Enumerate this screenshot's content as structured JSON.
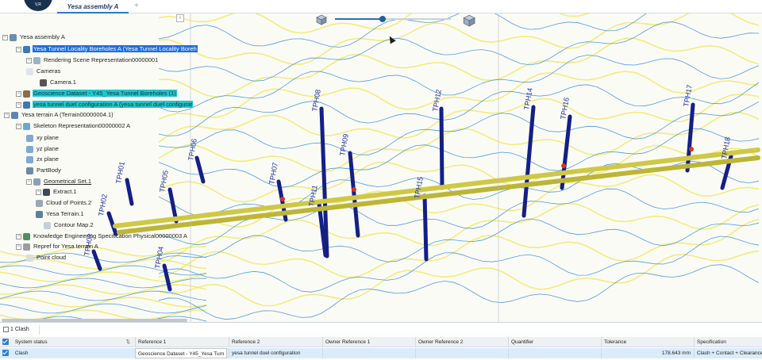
{
  "header": {
    "logo_text": "V,R",
    "tab_label": "Yesa assembly A",
    "add_tab_symbol": "+"
  },
  "tree": {
    "collapse_symbol": "‹",
    "nodes": [
      {
        "label": "Yesa assembly A",
        "icon": "assembly-icon",
        "style": ""
      },
      {
        "label": "Yesa Tunnel Locality Boreholes A (Yesa Tunnel Locality Boreh",
        "icon": "product-icon",
        "style": "sel-blue"
      },
      {
        "label": "Rendering Scene Representation00000001",
        "icon": "scene-icon",
        "style": ""
      },
      {
        "label": "Cameras",
        "icon": "folder-icon",
        "style": ""
      },
      {
        "label": "Camera.1",
        "icon": "camera-icon",
        "style": ""
      },
      {
        "label": "Geoscience Dataset - Y45_Yesa Tunnel Boreholes (1)",
        "icon": "dataset-icon",
        "style": "sel-cyan"
      },
      {
        "label": "yesa tunnel duel configuration A (yesa tunnel duel configurat",
        "icon": "product-icon",
        "style": "sel-cyan"
      },
      {
        "label": "Yesa terrain A (Terrain00000004.1)",
        "icon": "terrain-icon",
        "style": ""
      },
      {
        "label": "Skeleton Representation00000002 A",
        "icon": "skeleton-icon",
        "style": ""
      },
      {
        "label": "xy plane",
        "icon": "plane-icon",
        "style": ""
      },
      {
        "label": "yz plane",
        "icon": "plane-icon",
        "style": ""
      },
      {
        "label": "zx plane",
        "icon": "plane-icon",
        "style": ""
      },
      {
        "label": "PartBody",
        "icon": "partbody-icon",
        "style": ""
      },
      {
        "label": "Geometrical Set.1",
        "icon": "geoset-icon",
        "style": "underline"
      },
      {
        "label": "Extract.1",
        "icon": "extract-icon",
        "style": ""
      },
      {
        "label": "Cloud of Points.2",
        "icon": "points-icon",
        "style": ""
      },
      {
        "label": "Yesa Terrain.1",
        "icon": "terrain-surface-icon",
        "style": ""
      },
      {
        "label": "Contour Map.2",
        "icon": "contour-icon",
        "style": ""
      },
      {
        "label": "Knowledge Engineering Specification Physical00000003 A",
        "icon": "knowledge-icon",
        "style": ""
      },
      {
        "label": "Repref for Yesa terrain A",
        "icon": "repref-icon",
        "style": ""
      },
      {
        "label": "Point cloud",
        "icon": "pointcloud-icon",
        "style": ""
      }
    ]
  },
  "boreholes": [
    {
      "label": "TPH01"
    },
    {
      "label": "TPH02"
    },
    {
      "label": "TPH03"
    },
    {
      "label": "TPH04"
    },
    {
      "label": "TPH05"
    },
    {
      "label": "TPH06"
    },
    {
      "label": "TPH07"
    },
    {
      "label": "TPH08"
    },
    {
      "label": "TPH09"
    },
    {
      "label": "TPH11"
    },
    {
      "label": "TPH12"
    },
    {
      "label": "TPH14"
    },
    {
      "label": "TPH15"
    },
    {
      "label": "TPH16"
    },
    {
      "label": "TPH17"
    },
    {
      "label": "TPH18"
    }
  ],
  "clash_panel": {
    "tab_label": "1 Clash",
    "columns": [
      "System status",
      "Reference 1",
      "Reference 2",
      "Owner Reference 1",
      "Owner Reference 2",
      "Quantifier",
      "Tolerance",
      "Specification"
    ],
    "rows": [
      {
        "status": "Clash",
        "reference_1": "Geoscience Dataset - Y45_Yesa Turn",
        "reference_2": "yesa tunnel duel configuration",
        "owner_reference_1": "",
        "owner_reference_2": "",
        "quantifier": "",
        "tolerance": "178.643 mm",
        "specification": "Clash + Contact + Clearance"
      }
    ]
  },
  "colors": {
    "accent": "#2d77c9",
    "selection_blue": "#1b6ee6",
    "selection_cyan": "#1fc6cf",
    "contour_blue": "#4e9be0",
    "contour_yellow": "#f2ec7c",
    "borehole": "#141f86",
    "tunnel": "#cfc846",
    "clash_red": "#e0331b"
  }
}
